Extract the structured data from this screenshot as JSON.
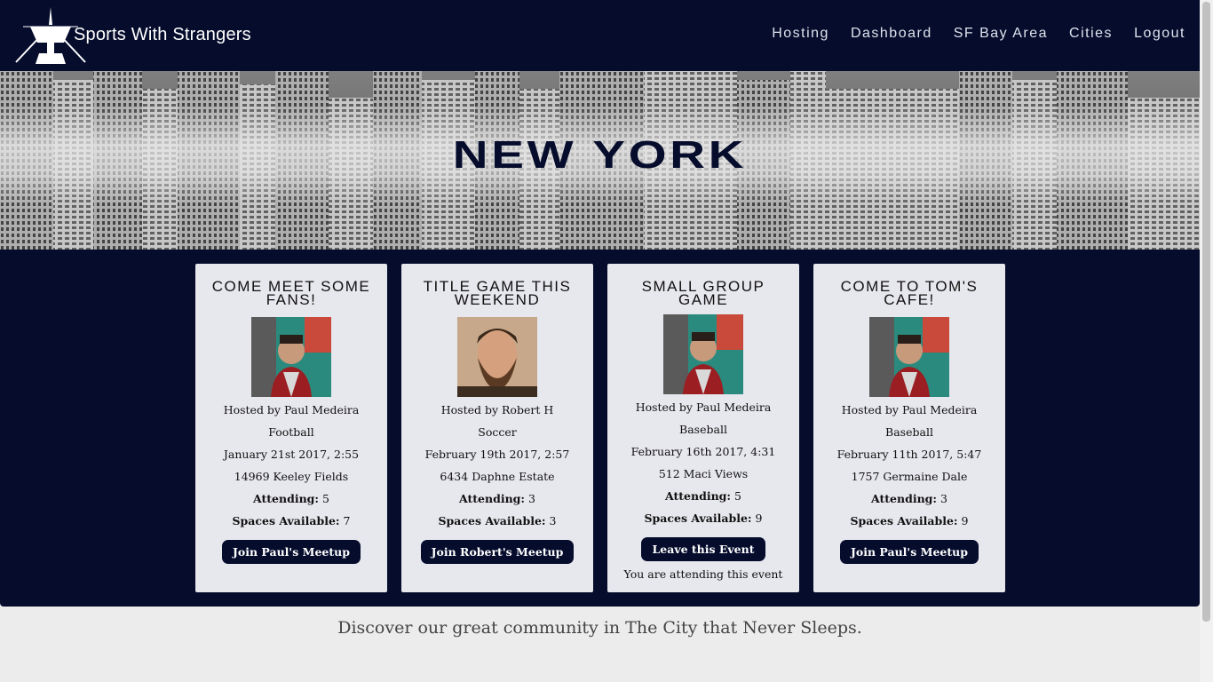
{
  "header": {
    "logo_text": "Sports With Strangers",
    "nav": [
      "Hosting",
      "Dashboard",
      "SF Bay Area",
      "Cities",
      "Logout"
    ]
  },
  "hero": {
    "title": "New York"
  },
  "events": [
    {
      "title": "Come Meet Some Fans!",
      "host": "Hosted by Paul Medeira",
      "sport": "Football",
      "date": "January 21st 2017, 2:55",
      "address": "14969 Keeley Fields",
      "attending_label": "Attending:",
      "attending": "5",
      "spaces_label": "Spaces Available:",
      "spaces": "7",
      "button": "Join Paul's Meetup",
      "note": ""
    },
    {
      "title": "Title Game This Weekend",
      "host": "Hosted by Robert H",
      "sport": "Soccer",
      "date": "February 19th 2017, 2:57",
      "address": "6434 Daphne Estate",
      "attending_label": "Attending:",
      "attending": "3",
      "spaces_label": "Spaces Available:",
      "spaces": "3",
      "button": "Join Robert's Meetup",
      "note": ""
    },
    {
      "title": "Small Group Game",
      "host": "Hosted by Paul Medeira",
      "sport": "Baseball",
      "date": "February 16th 2017, 4:31",
      "address": "512 Maci Views",
      "attending_label": "Attending:",
      "attending": "5",
      "spaces_label": "Spaces Available:",
      "spaces": "9",
      "button": "Leave this Event",
      "note": "You are attending this event"
    },
    {
      "title": "Come To Tom's Cafe!",
      "host": "Hosted by Paul Medeira",
      "sport": "Baseball",
      "date": "February 11th 2017, 5:47",
      "address": "1757 Germaine Dale",
      "attending_label": "Attending:",
      "attending": "3",
      "spaces_label": "Spaces Available:",
      "spaces": "9",
      "button": "Join Paul's Meetup",
      "note": ""
    }
  ],
  "footer": {
    "tagline": "Discover our great community in The City that Never Sleeps."
  },
  "colors": {
    "navy": "#050c2c",
    "card": "#e7e7ee",
    "page": "#ececec"
  }
}
